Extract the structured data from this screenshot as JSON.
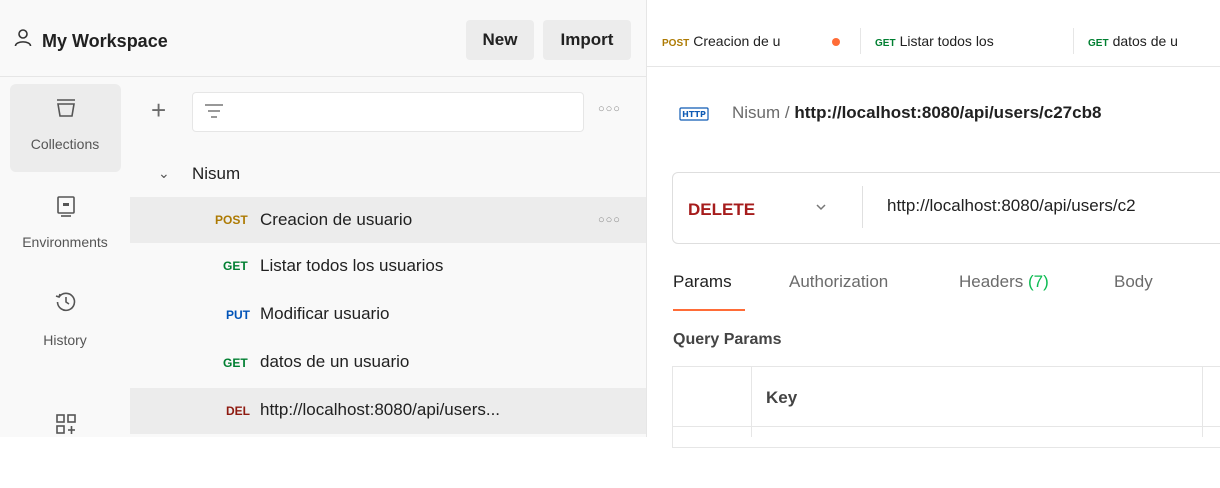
{
  "workspace": {
    "title": "My Workspace",
    "new_label": "New",
    "import_label": "Import"
  },
  "rail": {
    "items": [
      {
        "label": "Collections",
        "icon": "collections-icon"
      },
      {
        "label": "Environments",
        "icon": "environments-icon"
      },
      {
        "label": "History",
        "icon": "history-icon"
      },
      {
        "label": "",
        "icon": "add-apps-icon"
      }
    ]
  },
  "sidebar": {
    "collection_name": "Nisum",
    "requests": [
      {
        "method": "POST",
        "name": "Creacion de usuario"
      },
      {
        "method": "GET",
        "name": "Listar todos los usuarios"
      },
      {
        "method": "PUT",
        "name": "Modificar usuario"
      },
      {
        "method": "GET",
        "name": "datos de un usuario"
      },
      {
        "method": "DEL",
        "name": "http://localhost:8080/api/users..."
      }
    ]
  },
  "tabs": [
    {
      "method": "POST",
      "name": "Creacion de u"
    },
    {
      "method": "GET",
      "name": "Listar todos los"
    },
    {
      "method": "GET",
      "name": "datos de u"
    }
  ],
  "request": {
    "breadcrumb_parent": "Nisum",
    "breadcrumb_sep": "/",
    "breadcrumb_title": "http://localhost:8080/api/users/c27cb8",
    "method": "DELETE",
    "url": "http://localhost:8080/api/users/c2",
    "param_tabs": {
      "params": "Params",
      "authorization": "Authorization",
      "headers": "Headers",
      "headers_count": "(7)",
      "body": "Body"
    },
    "query_params_title": "Query Params",
    "table_key_header": "Key"
  },
  "colors": {
    "post": "#ad7a03",
    "get": "#007f31",
    "put": "#0053b8",
    "del": "#8e1a10",
    "accent": "#ff6c37",
    "headers_count": "#0cbb52"
  }
}
